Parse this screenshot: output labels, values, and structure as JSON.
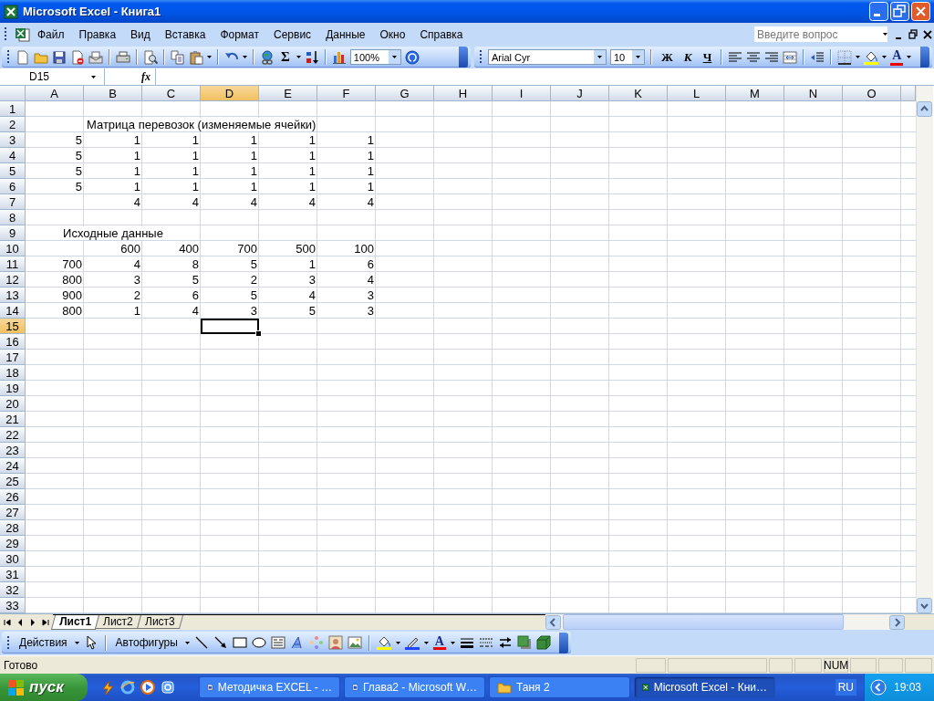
{
  "window": {
    "title": "Microsoft Excel - Книга1"
  },
  "menu": [
    "Файл",
    "Правка",
    "Вид",
    "Вставка",
    "Формат",
    "Сервис",
    "Данные",
    "Окно",
    "Справка"
  ],
  "help_search": {
    "placeholder": "Введите вопрос"
  },
  "standard_toolbar": {
    "sum": "Σ",
    "zoom": "100%"
  },
  "formatting_toolbar": {
    "font": "Arial Cyr",
    "size": "10",
    "bold": "Ж",
    "italic": "К",
    "underline": "Ч",
    "font_color": "A"
  },
  "formula_bar": {
    "name_box": "D15",
    "function_label": "fx"
  },
  "sheet": {
    "columns": [
      {
        "name": "A",
        "selected": false
      },
      {
        "name": "B",
        "selected": false
      },
      {
        "name": "C",
        "selected": false
      },
      {
        "name": "D",
        "selected": true
      },
      {
        "name": "E",
        "selected": false
      },
      {
        "name": "F",
        "selected": false
      },
      {
        "name": "G",
        "selected": false
      },
      {
        "name": "H",
        "selected": false
      },
      {
        "name": "I",
        "selected": false
      },
      {
        "name": "J",
        "selected": false
      },
      {
        "name": "K",
        "selected": false
      },
      {
        "name": "L",
        "selected": false
      },
      {
        "name": "M",
        "selected": false
      },
      {
        "name": "N",
        "selected": false
      },
      {
        "name": "O",
        "selected": false
      }
    ],
    "rows": [
      {
        "number": "1",
        "selected": false
      },
      {
        "number": "2",
        "selected": false,
        "cells": {
          "B": {
            "text": "Матрица перевозок (изменяемые ячейки)",
            "kind": "label"
          }
        }
      },
      {
        "number": "3",
        "selected": false,
        "cells": {
          "A": "5",
          "B": "1",
          "C": "1",
          "D": "1",
          "E": "1",
          "F": "1"
        }
      },
      {
        "number": "4",
        "selected": false,
        "cells": {
          "A": "5",
          "B": "1",
          "C": "1",
          "D": "1",
          "E": "1",
          "F": "1"
        }
      },
      {
        "number": "5",
        "selected": false,
        "cells": {
          "A": "5",
          "B": "1",
          "C": "1",
          "D": "1",
          "E": "1",
          "F": "1"
        }
      },
      {
        "number": "6",
        "selected": false,
        "cells": {
          "A": "5",
          "B": "1",
          "C": "1",
          "D": "1",
          "E": "1",
          "F": "1"
        }
      },
      {
        "number": "7",
        "selected": false,
        "cells": {
          "B": "4",
          "C": "4",
          "D": "4",
          "E": "4",
          "F": "4"
        }
      },
      {
        "number": "8",
        "selected": false
      },
      {
        "number": "9",
        "selected": false,
        "cells": {
          "B": {
            "text": "Исходные данные",
            "kind": "centered"
          }
        }
      },
      {
        "number": "10",
        "selected": false,
        "cells": {
          "B": "600",
          "C": "400",
          "D": "700",
          "E": "500",
          "F": "100"
        }
      },
      {
        "number": "11",
        "selected": false,
        "cells": {
          "A": "700",
          "B": "4",
          "C": "8",
          "D": "5",
          "E": "1",
          "F": "6"
        }
      },
      {
        "number": "12",
        "selected": false,
        "cells": {
          "A": "800",
          "B": "3",
          "C": "5",
          "D": "2",
          "E": "3",
          "F": "4"
        }
      },
      {
        "number": "13",
        "selected": false,
        "cells": {
          "A": "900",
          "B": "2",
          "C": "6",
          "D": "5",
          "E": "4",
          "F": "3"
        }
      },
      {
        "number": "14",
        "selected": false,
        "cells": {
          "A": "800",
          "B": "1",
          "C": "4",
          "D": "3",
          "E": "5",
          "F": "3"
        }
      },
      {
        "number": "15",
        "selected": true
      },
      {
        "number": "16",
        "selected": false
      },
      {
        "number": "17",
        "selected": false
      },
      {
        "number": "18",
        "selected": false
      },
      {
        "number": "19",
        "selected": false
      },
      {
        "number": "20",
        "selected": false
      },
      {
        "number": "21",
        "selected": false
      },
      {
        "number": "22",
        "selected": false
      },
      {
        "number": "23",
        "selected": false
      },
      {
        "number": "24",
        "selected": false
      },
      {
        "number": "25",
        "selected": false
      },
      {
        "number": "26",
        "selected": false
      },
      {
        "number": "27",
        "selected": false
      },
      {
        "number": "28",
        "selected": false
      },
      {
        "number": "29",
        "selected": false
      },
      {
        "number": "30",
        "selected": false
      },
      {
        "number": "31",
        "selected": false
      },
      {
        "number": "32",
        "selected": false
      },
      {
        "number": "33",
        "selected": false
      }
    ]
  },
  "sheet_tabs": [
    {
      "label": "Лист1",
      "selected": true
    },
    {
      "label": "Лист2",
      "selected": false
    },
    {
      "label": "Лист3",
      "selected": false
    }
  ],
  "drawing_toolbar": {
    "actions": "Действия",
    "autoshapes": "Автофигуры",
    "font_color": "A"
  },
  "status_bar": {
    "text": "Готово",
    "indicator": "NUM"
  },
  "taskbar": {
    "start": "пуск",
    "tasks": [
      {
        "label": "Методичка EXCEL - …",
        "kind": "word",
        "selected": false
      },
      {
        "label": "Глава2 - Microsoft W…",
        "kind": "word",
        "selected": false
      },
      {
        "label": "Таня 2",
        "kind": "folder",
        "selected": false
      },
      {
        "label": "Microsoft Excel - Кни…",
        "kind": "excel",
        "selected": true
      }
    ],
    "language": "RU",
    "clock": "19:03"
  }
}
